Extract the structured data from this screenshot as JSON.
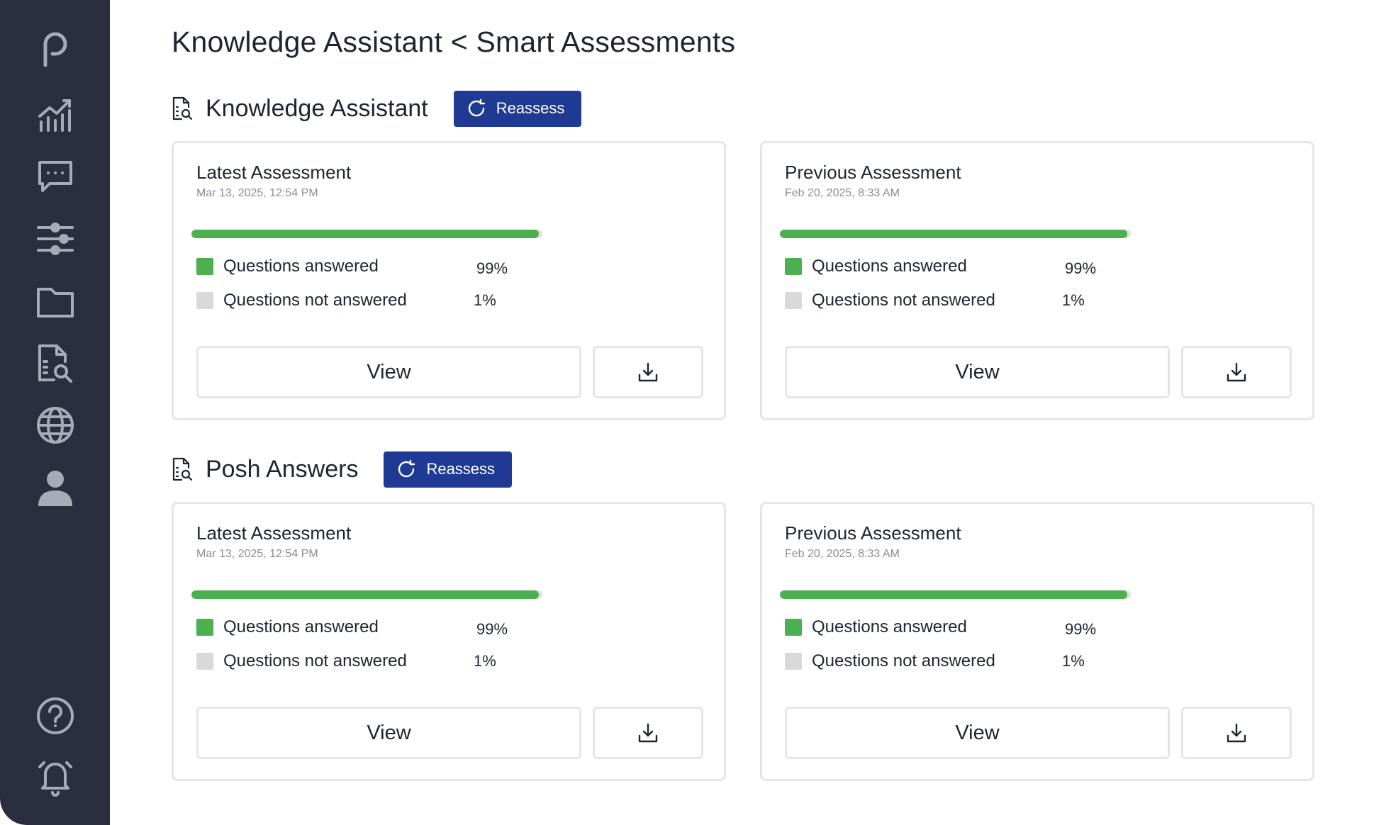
{
  "page": {
    "title": "Knowledge Assistant < Smart Assessments"
  },
  "colors": {
    "sidebar": "#2b2e3f",
    "accent": "#1f3a93",
    "answered": "#4caf50",
    "not_answered": "#d9d9d9"
  },
  "sidebar": {
    "icons": [
      "logo-icon",
      "analytics-icon",
      "chat-icon",
      "sliders-icon",
      "folder-icon",
      "document-search-icon",
      "globe-icon",
      "user-icon",
      "help-icon",
      "bell-icon"
    ]
  },
  "sections": [
    {
      "title": "Knowledge Assistant",
      "reassess_label": "Reassess",
      "cards": [
        {
          "title": "Latest Assessment",
          "date": "Mar 13, 2025, 12:54 PM",
          "progress": 0.99,
          "answered_label": "Questions answered",
          "answered_pct": "99%",
          "not_answered_label": "Questions not answered",
          "not_answered_pct": "1%",
          "view_label": "View"
        },
        {
          "title": "Previous Assessment",
          "date": "Feb 20, 2025, 8:33 AM",
          "progress": 0.99,
          "answered_label": "Questions answered",
          "answered_pct": "99%",
          "not_answered_label": "Questions not answered",
          "not_answered_pct": "1%",
          "view_label": "View"
        }
      ]
    },
    {
      "title": "Posh Answers",
      "reassess_label": "Reassess",
      "cards": [
        {
          "title": "Latest Assessment",
          "date": "Mar 13, 2025, 12:54 PM",
          "progress": 0.99,
          "answered_label": "Questions answered",
          "answered_pct": "99%",
          "not_answered_label": "Questions not answered",
          "not_answered_pct": "1%",
          "view_label": "View"
        },
        {
          "title": "Previous Assessment",
          "date": "Feb 20, 2025, 8:33 AM",
          "progress": 0.99,
          "answered_label": "Questions answered",
          "answered_pct": "99%",
          "not_answered_label": "Questions not answered",
          "not_answered_pct": "1%",
          "view_label": "View"
        }
      ]
    }
  ]
}
